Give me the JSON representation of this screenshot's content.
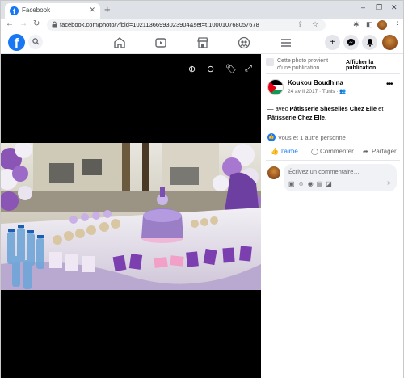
{
  "browser": {
    "tab_title": "Facebook",
    "tab_favicon": "f",
    "tab_close": "✕",
    "new_tab": "+",
    "window_controls": [
      "–",
      "❐",
      "✕"
    ],
    "url": "facebook.com/photo/?fbid=10211366993023904&set=t.100010768057678"
  },
  "fb_header": {
    "logo": "f"
  },
  "notice": {
    "text": "Cette photo provient d'une publication.",
    "button": "Afficher la publication"
  },
  "post": {
    "author": "Koukou Boudhina",
    "meta": "24 avril 2017 · Tunis · 👥",
    "caption_prefix": "— avec ",
    "tag1": "Pâtisserie Sheselles Chez Elle",
    "caption_mid": " et ",
    "tag2": "Pâtisserie Chez Elle",
    "caption_end": ".",
    "more": "•••",
    "likes_text": "Vous et 1 autre personne"
  },
  "actions": {
    "like": "J'aime",
    "comment": "Commenter",
    "share": "Partager"
  },
  "comment": {
    "placeholder": "Écrivez un commentaire…"
  },
  "colors": {
    "brand": "#1877f2"
  }
}
